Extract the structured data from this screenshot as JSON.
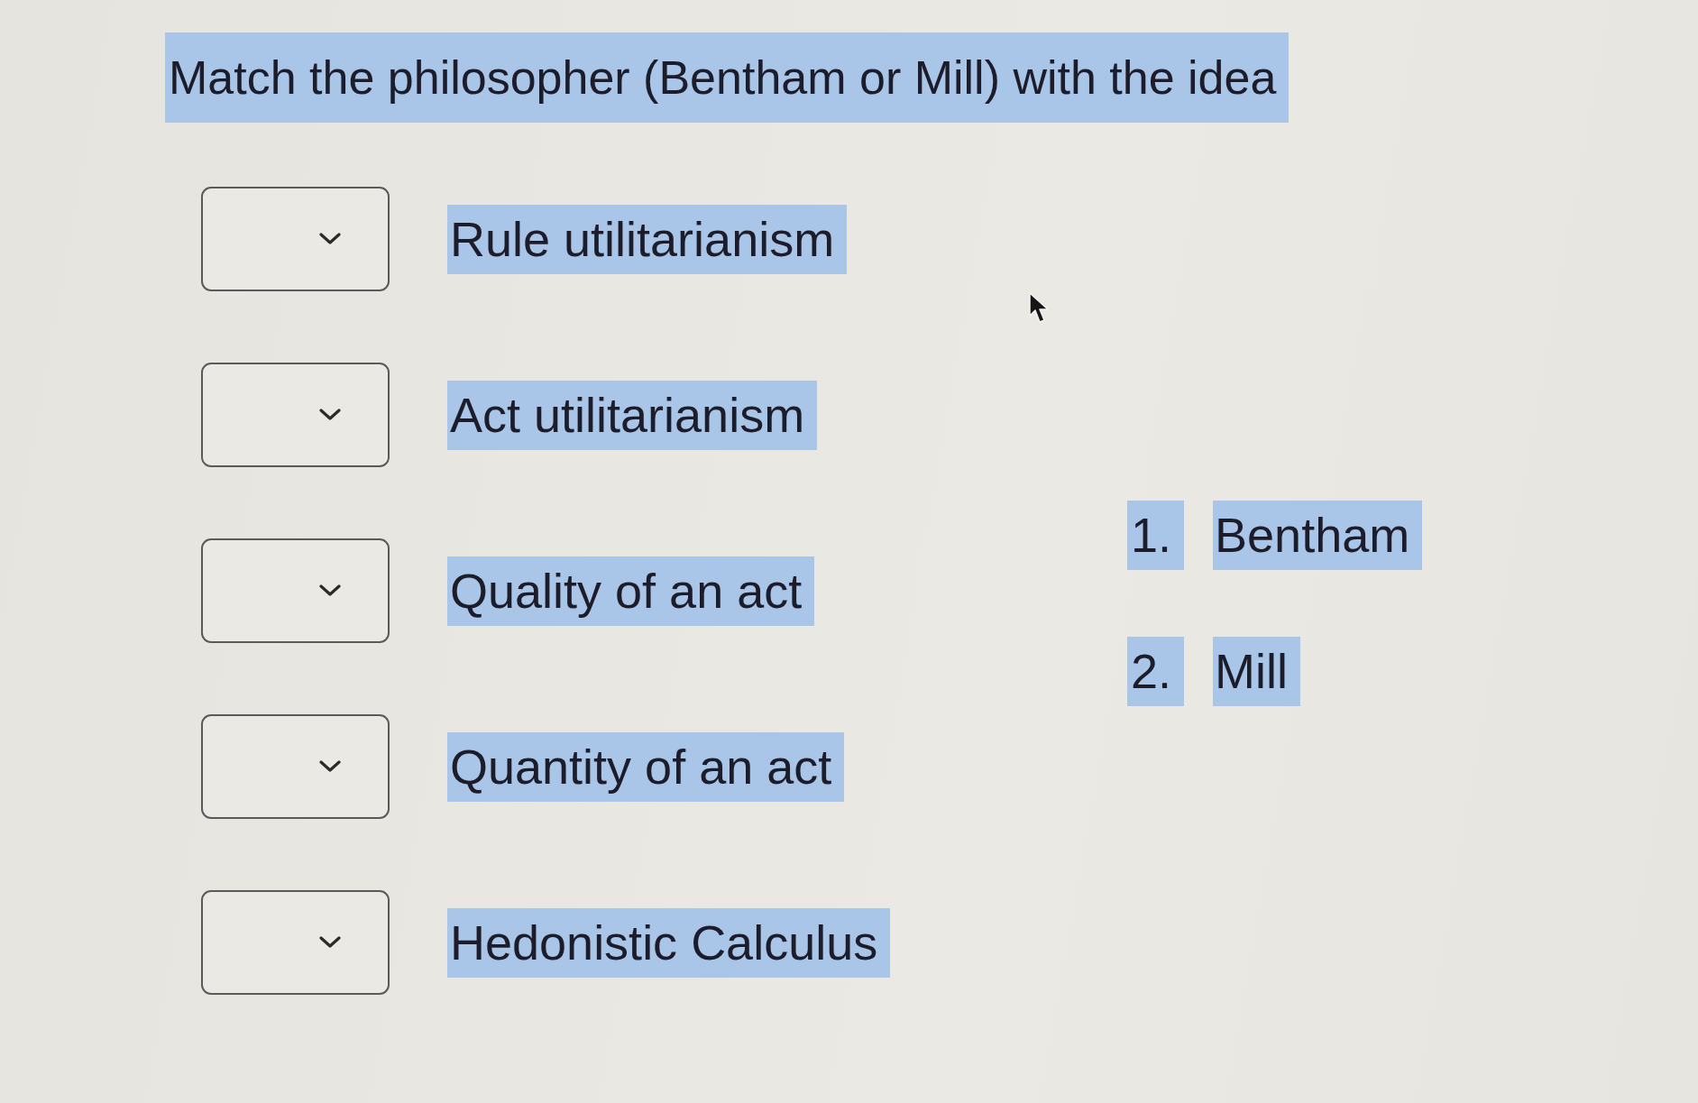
{
  "question": {
    "title": "Match the philosopher (Bentham or Mill) with the idea"
  },
  "matches": [
    {
      "idea": "Rule utilitarianism"
    },
    {
      "idea": "Act utilitarianism"
    },
    {
      "idea": "Quality of an act"
    },
    {
      "idea": "Quantity of an act"
    },
    {
      "idea": "Hedonistic Calculus"
    }
  ],
  "options": [
    {
      "number": "1.",
      "name": "Bentham"
    },
    {
      "number": "2.",
      "name": "Mill"
    }
  ]
}
